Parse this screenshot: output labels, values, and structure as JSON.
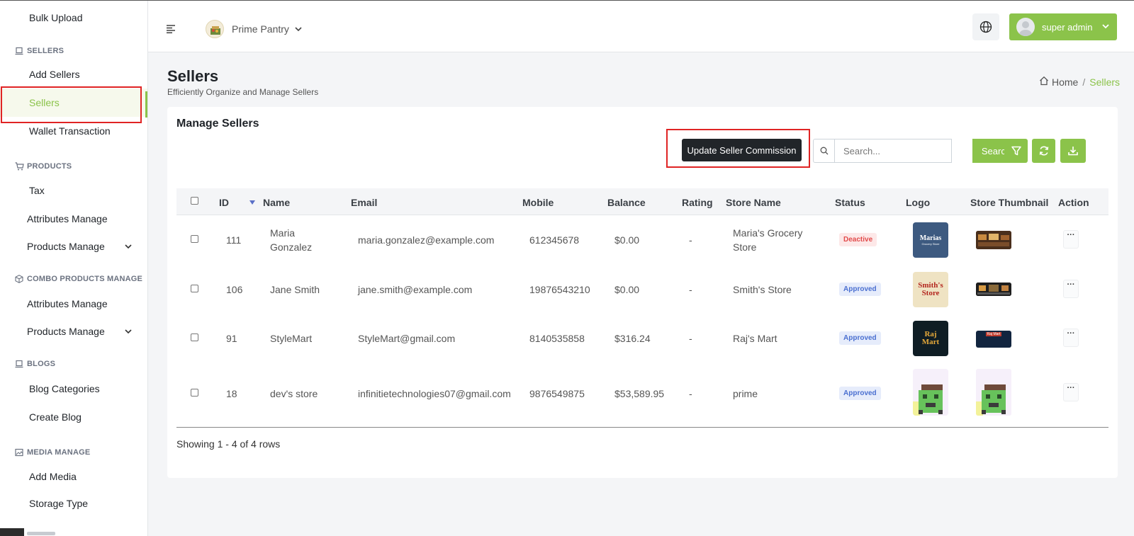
{
  "sidebar": {
    "bulk_upload": "Bulk Upload",
    "sellers_section": "SELLERS",
    "add_sellers": "Add Sellers",
    "sellers": "Sellers",
    "wallet_transaction": "Wallet Transaction",
    "products_section": "PRODUCTS",
    "tax": "Tax",
    "attributes_manage": "Attributes Manage",
    "products_manage": "Products Manage",
    "combo_section": "COMBO PRODUCTS MANAGE",
    "combo_attributes_manage": "Attributes Manage",
    "combo_products_manage": "Products Manage",
    "blogs_section": "BLOGS",
    "blog_categories": "Blog Categories",
    "create_blog": "Create Blog",
    "media_section": "MEDIA MANAGE",
    "add_media": "Add Media",
    "storage_type": "Storage Type"
  },
  "header": {
    "store_name": "Prime Pantry",
    "user_name": "super admin"
  },
  "page": {
    "title": "Sellers",
    "subtitle": "Efficiently Organize and Manage Sellers",
    "breadcrumb_home": "Home",
    "breadcrumb_sep": "/",
    "breadcrumb_current": "Sellers"
  },
  "card": {
    "title": "Manage Sellers",
    "update_commission_label": "Update Seller Commission",
    "search_placeholder": "Search...",
    "search_label": "Search"
  },
  "table": {
    "headers": {
      "id": "ID",
      "name": "Name",
      "email": "Email",
      "mobile": "Mobile",
      "balance": "Balance",
      "rating": "Rating",
      "store_name": "Store Name",
      "status": "Status",
      "logo": "Logo",
      "thumbnail": "Store Thumbnail",
      "action": "Action"
    },
    "rows": [
      {
        "id": "111",
        "name_line1": "Maria",
        "name_line2": "Gonzalez",
        "email": "maria.gonzalez@example.com",
        "mobile": "612345678",
        "balance": "$0.00",
        "rating": "-",
        "store_line1": "Maria's Grocery",
        "store_line2": "Store",
        "status": "Deactive",
        "logo_text1": "Marias",
        "logo_text2": "Grocery Store",
        "action": "···"
      },
      {
        "id": "106",
        "name": "Jane Smith",
        "email": "jane.smith@example.com",
        "mobile": "19876543210",
        "balance": "$0.00",
        "rating": "-",
        "store": "Smith's Store",
        "status": "Approved",
        "logo_text1": "Smith's",
        "logo_text2": "Store",
        "action": "···"
      },
      {
        "id": "91",
        "name": "StyleMart",
        "email": "StyleMart@gmail.com",
        "mobile": "8140535858",
        "balance": "$316.24",
        "rating": "-",
        "store": "Raj's Mart",
        "status": "Approved",
        "logo_text1": "Raj",
        "logo_text2": "Mart",
        "thumb_text": "Raj Mart",
        "action": "···"
      },
      {
        "id": "18",
        "name": "dev's store",
        "email": "infinitietechnologies07@gmail.com",
        "mobile": "9876549875",
        "balance": "$53,589.95",
        "rating": "-",
        "store": "prime",
        "status": "Approved",
        "action": "···"
      }
    ],
    "showing": "Showing 1 - 4 of 4 rows"
  },
  "colors": {
    "accent": "#8bc34a",
    "dark_button": "#212529",
    "highlight": "#e02424"
  }
}
